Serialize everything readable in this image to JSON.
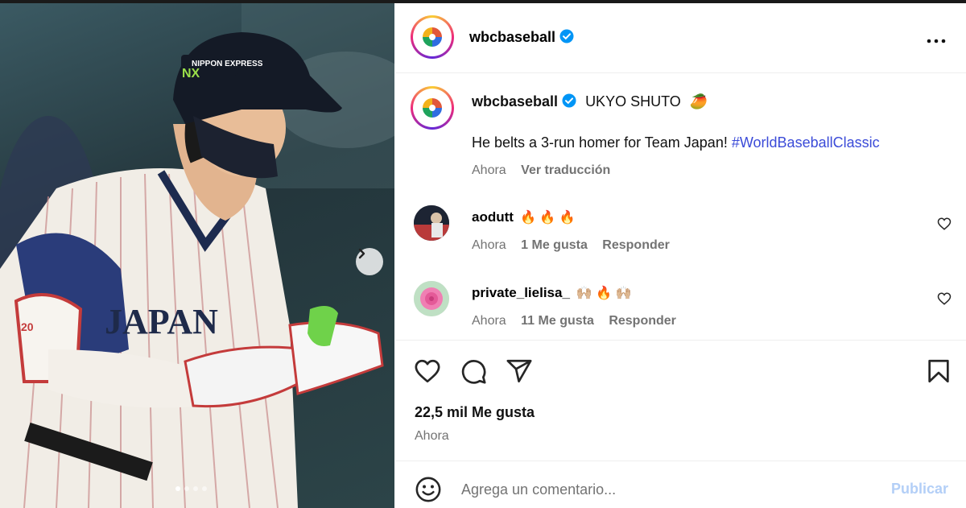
{
  "post": {
    "author": "wbcbaseball",
    "image_count": 4,
    "active_image": 1
  },
  "caption": {
    "author": "wbcbaseball",
    "title": "UKYO SHUTO",
    "title_emoji": "🥭",
    "text": "He belts a 3-run homer for Team Japan!",
    "hashtag": "#WorldBaseballClassic",
    "time": "Ahora",
    "translate": "Ver traducción"
  },
  "comments": [
    {
      "user": "aodutt",
      "text": "🔥 🔥 🔥",
      "time": "Ahora",
      "likes": "1 Me gusta",
      "reply": "Responder"
    },
    {
      "user": "private_lielisa_",
      "text": "🙌🏼 🔥 🙌🏼",
      "time": "Ahora",
      "likes": "11 Me gusta",
      "reply": "Responder"
    }
  ],
  "stats": {
    "likes": "22,5 mil Me gusta",
    "time": "Ahora"
  },
  "composer": {
    "placeholder": "Agrega un comentario...",
    "publish": "Publicar"
  },
  "photo": {
    "helmet_text": "NIPPON EXPRESS",
    "helmet_logo": "NX",
    "jersey_text": "JAPAN",
    "sleeve_number": "20"
  },
  "colors": {
    "verified": "#0095f6",
    "link": "#3b4bd8",
    "publish_disabled": "#b3cff7",
    "muted": "#737373"
  }
}
